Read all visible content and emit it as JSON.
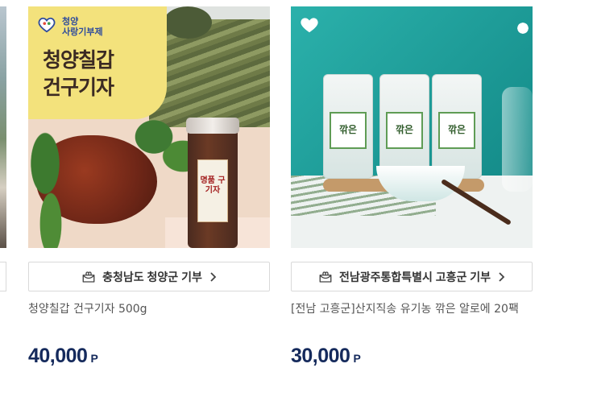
{
  "products": [
    {
      "region_button": "충청남도 청양군 기부",
      "title": "청양칠갑 건구기자 500g",
      "price": "40,000",
      "price_unit": "P",
      "image": {
        "logo_line1": "청양",
        "logo_line2": "사랑기부제",
        "headline_line1": "청양칠갑",
        "headline_line2": "건구기자",
        "jar_label": "명품 구기자"
      }
    },
    {
      "region_button": "전남광주통합특별시 고흥군 기부",
      "title": "[전남 고흥군]산지직송 유기농 깎은 알로에 20팩",
      "price": "30,000",
      "price_unit": "P",
      "image": {
        "bag_label": "깎은"
      }
    }
  ],
  "icons": {
    "wishlist": "heart-icon",
    "donate": "gift-box-icon",
    "chevron": "chevron-right-icon"
  },
  "colors": {
    "price": "#152a5c",
    "border": "#d9d9d9"
  }
}
